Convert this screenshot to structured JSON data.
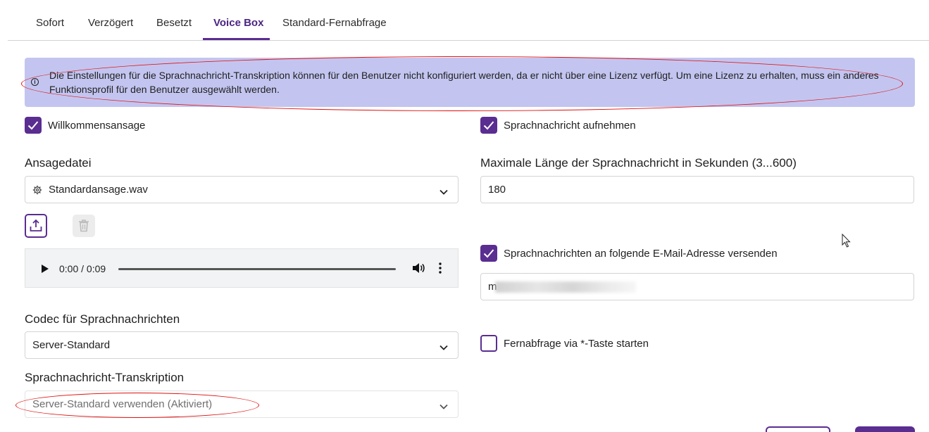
{
  "tabs": [
    {
      "label": "Sofort"
    },
    {
      "label": "Verzögert"
    },
    {
      "label": "Besetzt"
    },
    {
      "label": "Voice Box",
      "active": true
    },
    {
      "label": "Standard-Fernabfrage"
    }
  ],
  "info_banner": {
    "icon": "info-icon",
    "text": "Die Einstellungen für die Sprachnachricht-Transkription können für den Benutzer nicht konfiguriert werden, da er nicht über eine Lizenz verfügt. Um eine Lizenz zu erhalten, muss ein anderes Funktionsprofil für den Benutzer ausgewählt werden."
  },
  "left": {
    "welcome": {
      "label": "Willkommensansage",
      "checked": true
    },
    "announcement_file": {
      "label": "Ansagedatei",
      "value": "Standardansage.wav",
      "icon": "gear-icon"
    },
    "audio_player": {
      "time": "0:00 / 0:09",
      "progress": 0
    },
    "codec": {
      "label": "Codec für Sprachnachrichten",
      "value": "Server-Standard"
    },
    "transcription": {
      "label": "Sprachnachricht-Transkription",
      "value": "Server-Standard verwenden (Aktiviert)",
      "disabled": true
    }
  },
  "right": {
    "record": {
      "label": "Sprachnachricht aufnehmen",
      "checked": true
    },
    "max_length": {
      "label": "Maximale Länge der Sprachnachricht in Sekunden (3...600)",
      "value": "180"
    },
    "send_email": {
      "label": "Sprachnachrichten an folgende E-Mail-Adresse versenden",
      "checked": true
    },
    "email": {
      "visible_prefix": "m"
    },
    "remote_access": {
      "label": "Fernabfrage via *-Taste starten",
      "checked": false
    }
  },
  "colors": {
    "accent": "#5a2d91",
    "banner_bg": "#c3c5f0",
    "annotation": "#e01010"
  }
}
